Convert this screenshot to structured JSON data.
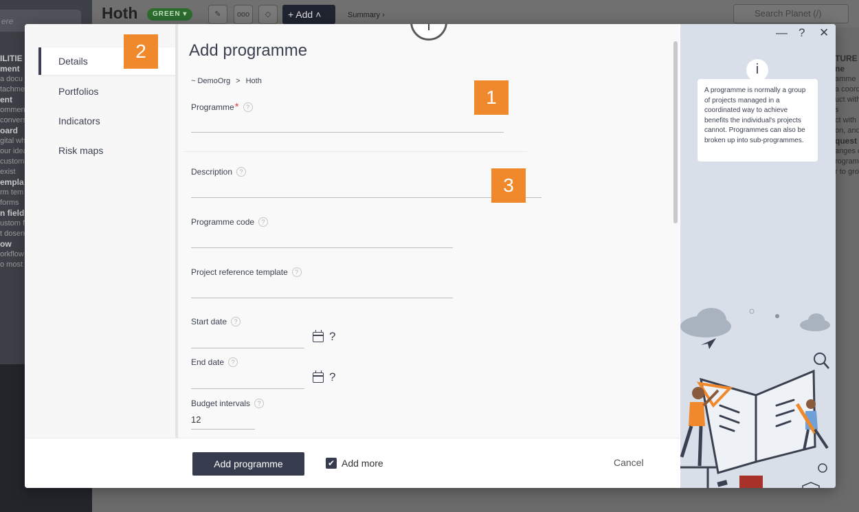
{
  "background": {
    "left_search": "ere",
    "title": "Hoth",
    "status_badge": "GREEN",
    "add_button": "Add",
    "summary_link": "Summary ›",
    "search_placeholder": "Search Planet (/)",
    "left_list": [
      "ILITIE",
      "ment",
      "a docu",
      "tachme",
      "ent",
      "omment",
      "convers",
      "oard",
      "gital wh",
      "our idea",
      "custom",
      "exist",
      "empla",
      "rm tem",
      "forms",
      "n field",
      "ustom fi",
      "t dosen",
      "ow",
      "orkflow",
      "o most"
    ],
    "right_list": [
      "TURE",
      "ne",
      "amme",
      "a coord",
      "uct with",
      "s",
      "ct with",
      "on, and",
      "quest",
      "anges c",
      "rogram",
      "r to gro"
    ]
  },
  "modal": {
    "title": "Add programme",
    "nav": [
      {
        "label": "Details",
        "active": true
      },
      {
        "label": "Portfolios",
        "active": false
      },
      {
        "label": "Indicators",
        "active": false
      },
      {
        "label": "Risk maps",
        "active": false
      }
    ],
    "breadcrumb": [
      "~ DemoOrg",
      "Hoth"
    ],
    "breadcrumb_separator": ">",
    "fields": {
      "programme": {
        "label": "Programme",
        "required_mark": "*",
        "value": ""
      },
      "description": {
        "label": "Description",
        "value": ""
      },
      "programme_code": {
        "label": "Programme code",
        "value": ""
      },
      "project_reference_template": {
        "label": "Project reference template",
        "value": ""
      },
      "start_date": {
        "label": "Start date",
        "value": "",
        "help": "?"
      },
      "end_date": {
        "label": "End date",
        "value": "",
        "help": "?"
      },
      "budget_intervals": {
        "label": "Budget intervals",
        "value": "12"
      }
    },
    "help_glyph": "?",
    "markers": [
      "1",
      "2",
      "3"
    ],
    "footer": {
      "submit_label": "Add programme",
      "add_more_label": "Add more",
      "add_more_checked": true,
      "cancel_label": "Cancel"
    },
    "window_controls": {
      "minimize": "—",
      "help": "?",
      "close": "✕"
    },
    "info": {
      "icon": "i",
      "text": "A programme is normally a group of projects managed in a coordinated way to achieve benefits the individual's projects cannot. Programmes can also be broken up into sub-programmes."
    }
  },
  "colors": {
    "accent_dark": "#363c4d",
    "marker_orange": "#f0892b",
    "status_green": "#2d6b2f",
    "info_panel": "#d8dfe8"
  }
}
